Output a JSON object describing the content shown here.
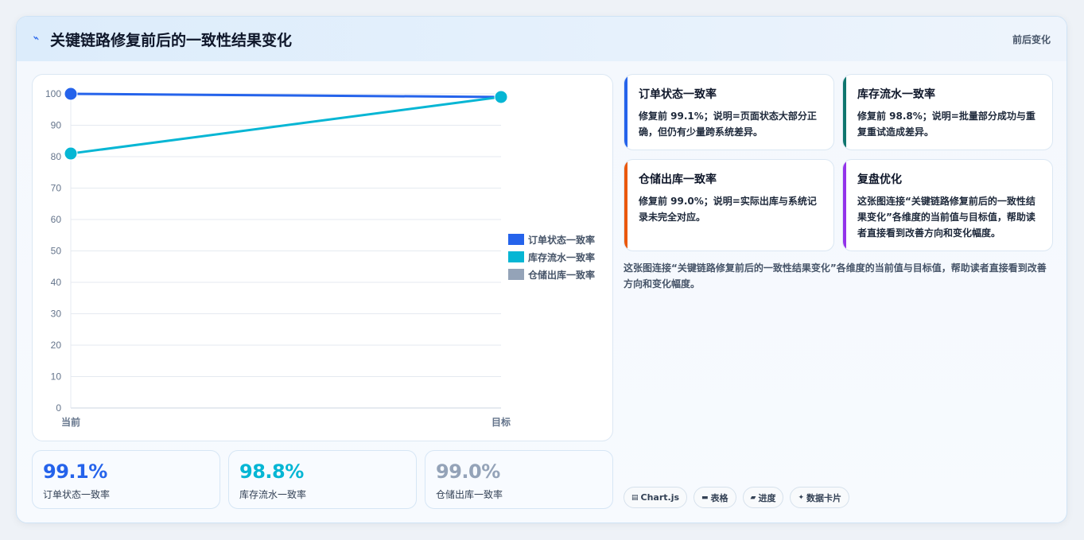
{
  "header": {
    "icon": "bolt-icon",
    "title": "关键链路修复前后的一致性结果变化",
    "right_label": "前后变化"
  },
  "chart_data": {
    "type": "line",
    "x": [
      "当前",
      "目标"
    ],
    "ylim": [
      0,
      100
    ],
    "yticks": [
      0,
      10,
      20,
      30,
      40,
      50,
      60,
      70,
      80,
      90,
      100
    ],
    "grid": true,
    "legend_position": "right",
    "series": [
      {
        "name": "订单状态一致率",
        "color": "#2563eb",
        "values": [
          100,
          99
        ]
      },
      {
        "name": "库存流水一致率",
        "color": "#06b6d4",
        "values": [
          81,
          99
        ]
      },
      {
        "name": "仓储出库一致率",
        "color": "#94a3b8",
        "values": [
          null,
          null
        ]
      }
    ]
  },
  "stats": [
    {
      "value": "99.1%",
      "label": "订单状态一致率",
      "color": "#2563eb"
    },
    {
      "value": "98.8%",
      "label": "库存流水一致率",
      "color": "#06b6d4"
    },
    {
      "value": "99.0%",
      "label": "仓储出库一致率",
      "color": "#94a3b8"
    }
  ],
  "info_cards": [
    {
      "title": "订单状态一致率",
      "text": "修复前 99.1%；说明=页面状态大部分正确，但仍有少量跨系统差异。",
      "accent": "#2563eb"
    },
    {
      "title": "库存流水一致率",
      "text": "修复前 98.8%；说明=批量部分成功与重复重试造成差异。",
      "accent": "#0f766e"
    },
    {
      "title": "仓储出库一致率",
      "text": "修复前 99.0%；说明=实际出库与系统记录未完全对应。",
      "accent": "#ea580c"
    },
    {
      "title": "复盘优化",
      "text": "这张图连接“关键链路修复前后的一致性结果变化”各维度的当前值与目标值，帮助读者直接看到改善方向和变化幅度。",
      "accent": "#9333ea"
    }
  ],
  "description": "这张图连接“关键链路修复前后的一致性结果变化”各维度的当前值与目标值，帮助读者直接看到改善方向和变化幅度。",
  "tags": [
    {
      "icon": "chart-icon",
      "label": "Chart.js"
    },
    {
      "icon": "table-icon",
      "label": "表格"
    },
    {
      "icon": "progress-icon",
      "label": "进度"
    },
    {
      "icon": "sparkle-icon",
      "label": "数据卡片"
    }
  ]
}
